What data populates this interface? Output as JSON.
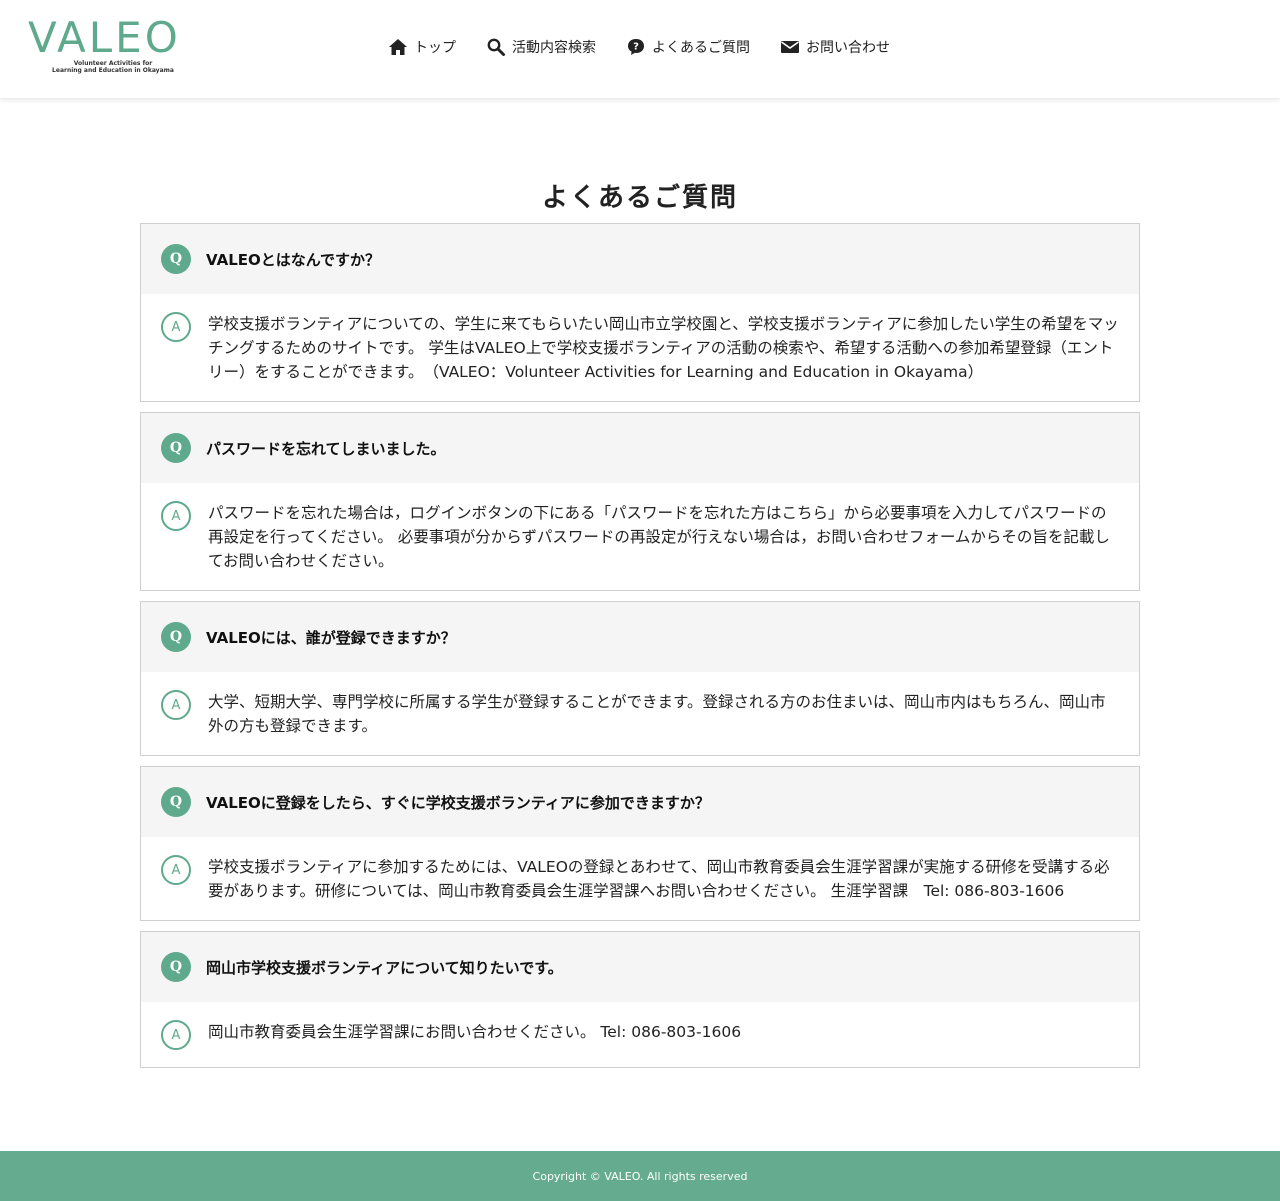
{
  "brand": {
    "name": "VALEO",
    "tagline_line1": "Volunteer Activities for",
    "tagline_line2": "Learning and Education in Okayama",
    "color": "#5fa98d"
  },
  "nav": {
    "items": [
      {
        "label": "トップ",
        "icon": "home-icon"
      },
      {
        "label": "活動内容検索",
        "icon": "search-icon"
      },
      {
        "label": "よくあるご質問",
        "icon": "question-bubble-icon"
      },
      {
        "label": "お問い合わせ",
        "icon": "mail-icon"
      }
    ]
  },
  "page": {
    "title": "よくあるご質問"
  },
  "faq": {
    "q_badge": "Q",
    "a_badge": "A",
    "items": [
      {
        "question": "VALEOとはなんですか？",
        "answer": "学校支援ボランティアについての、学生に来てもらいたい岡山市立学校園と、学校支援ボランティアに参加したい学生の希望をマッチングするためのサイトです。 学生はVALEO上で学校支援ボランティアの活動の検索や、希望する活動への参加希望登録（エントリー）をすることができます。　（VALEO：Volunteer Activities for Learning and Education in Okayama）"
      },
      {
        "question": "パスワードを忘れてしまいました。",
        "answer": "パスワードを忘れた場合は，ログインボタンの下にある「パスワードを忘れた方はこちら」から必要事項を入力してパスワードの再設定を行ってください。 必要事項が分からずパスワードの再設定が行えない場合は，お問い合わせフォームからその旨を記載してお問い合わせください。"
      },
      {
        "question": "VALEOには、誰が登録できますか？",
        "answer": "大学、短期大学、専門学校に所属する学生が登録することができます。登録される方のお住まいは、岡山市内はもちろん、岡山市外の方も登録できます。"
      },
      {
        "question": "VALEOに登録をしたら、すぐに学校支援ボランティアに参加できますか？",
        "answer": "学校支援ボランティアに参加するためには、VALEOの登録とあわせて、岡山市教育委員会生涯学習課が実施する研修を受講する必要があります。研修については、岡山市教育委員会生涯学習課へお問い合わせください。 生涯学習課　Tel: 086-803-1606"
      },
      {
        "question": "岡山市学校支援ボランティアについて知りたいです。",
        "answer": "岡山市教育委員会生涯学習課にお問い合わせください。 Tel: 086-803-1606"
      }
    ]
  },
  "footer": {
    "copyright": "Copyright © VALEO. All rights reserved",
    "color": "#65ab8f"
  }
}
